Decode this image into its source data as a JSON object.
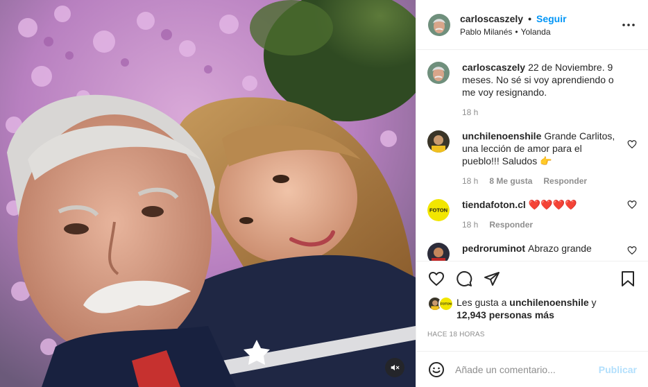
{
  "header": {
    "username": "carloscaszely",
    "dot": "•",
    "follow_label": "Seguir",
    "audio_artist": "Pablo Milanés",
    "audio_sep": "•",
    "audio_song": "Yolanda",
    "more_icon": "more-horizontal-icon"
  },
  "caption": {
    "username": "carloscaszely",
    "text": "22 de Noviembre. 9 meses. No sé si voy aprendiendo o me voy resignando.",
    "time": "18 h"
  },
  "comments": [
    {
      "username": "unchilenoenshile",
      "text": "Grande Carlitos, una lección de amor para el pueblo!!! Saludos 👉",
      "time": "18 h",
      "likes": "8 Me gusta",
      "reply": "Responder"
    },
    {
      "username": "tiendafoton.cl",
      "text": "❤️❤️❤️❤️",
      "time": "18 h",
      "reply": "Responder",
      "avatar_text": "FOTON"
    },
    {
      "username": "pedroruminot",
      "text": "Abrazo grande"
    }
  ],
  "likes": {
    "prefix": "Les gusta a ",
    "user": "unchilenoenshile",
    "middle": " y",
    "count": "12,943 personas más",
    "avatar_text": "FOTON"
  },
  "age": "HACE 18 HORAS",
  "add_comment": {
    "placeholder": "Añade un comentario...",
    "publish_label": "Publicar"
  },
  "colors": {
    "follow": "#0095f6",
    "publish_disabled": "#b2dffc",
    "muted_text": "#8e8e8e",
    "foton_yellow": "#f2e600"
  }
}
